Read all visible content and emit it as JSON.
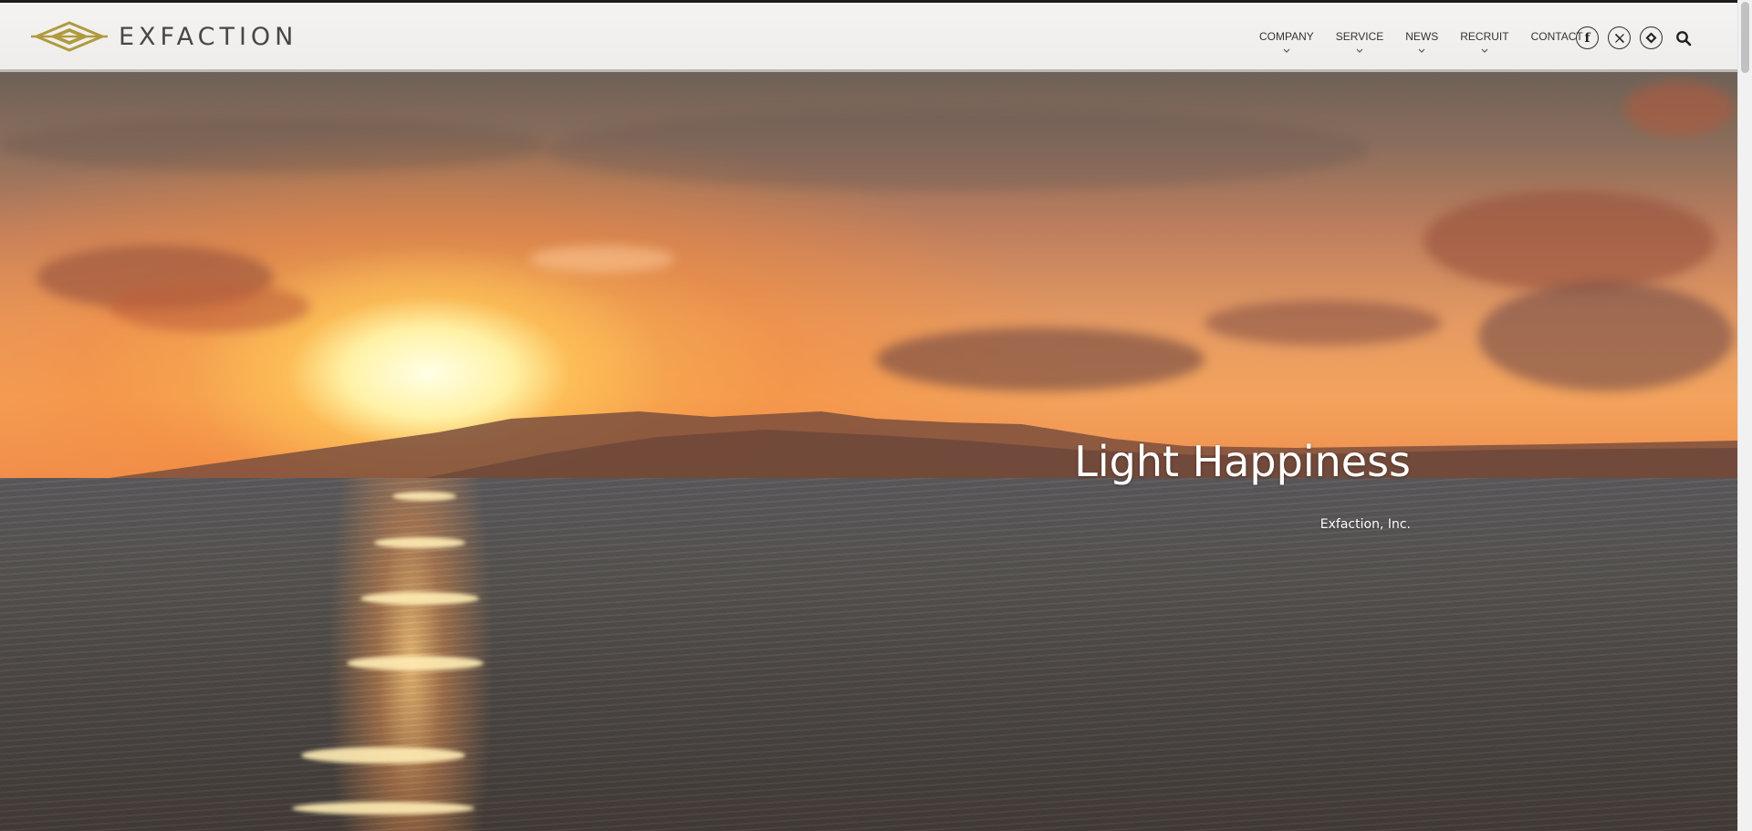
{
  "brand": {
    "name": "EXFACTION",
    "accent_color": "#b09a3e"
  },
  "nav": {
    "items": [
      {
        "label": "COMPANY",
        "has_dropdown": true
      },
      {
        "label": "SERVICE",
        "has_dropdown": true
      },
      {
        "label": "NEWS",
        "has_dropdown": true
      },
      {
        "label": "RECRUIT",
        "has_dropdown": true
      },
      {
        "label": "CONTACT",
        "has_dropdown": false
      }
    ]
  },
  "social": {
    "icons": [
      "facebook-icon",
      "x-icon",
      "feedly-icon"
    ],
    "facebook_glyph": "f",
    "x_glyph": "𝕏"
  },
  "search": {
    "icon": "search-icon"
  },
  "hero": {
    "title": "Light Happiness",
    "subtitle": "Exfaction, Inc."
  }
}
